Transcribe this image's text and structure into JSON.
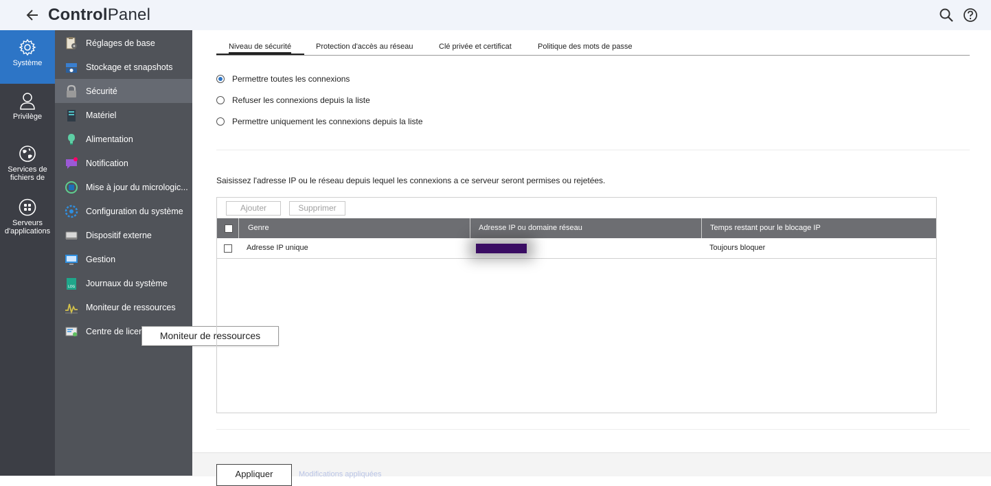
{
  "header": {
    "title_bold": "Control",
    "title_light": "Panel",
    "back_icon": "arrow-left-icon",
    "search_icon": "search-icon",
    "help_icon": "help-icon"
  },
  "rail": {
    "items": [
      {
        "label": "Système",
        "icon": "gear-icon",
        "active": true
      },
      {
        "label": "Privilège",
        "icon": "user-icon"
      },
      {
        "label": "Services de fichiers de",
        "icon": "globe-icon"
      },
      {
        "label": "Serveurs d'applications",
        "icon": "apps-grid-icon"
      }
    ]
  },
  "subnav": {
    "items": [
      {
        "label": "Réglages de base",
        "icon": "settings-clipboard-icon"
      },
      {
        "label": "Stockage et snapshots",
        "icon": "storage-icon"
      },
      {
        "label": "Sécurité",
        "icon": "lock-icon",
        "active": true
      },
      {
        "label": "Matériel",
        "icon": "hardware-icon"
      },
      {
        "label": "Alimentation",
        "icon": "power-bulb-icon"
      },
      {
        "label": "Notification",
        "icon": "notification-icon"
      },
      {
        "label": "Mise à jour du micrologic...",
        "icon": "firmware-update-icon"
      },
      {
        "label": "Configuration du système",
        "icon": "system-config-icon"
      },
      {
        "label": "Dispositif externe",
        "icon": "external-device-icon"
      },
      {
        "label": "Gestion",
        "icon": "monitor-icon"
      },
      {
        "label": "Journaux du système",
        "icon": "log-icon"
      },
      {
        "label": "Moniteur de ressources",
        "icon": "resource-monitor-icon"
      },
      {
        "label": "Centre de licences",
        "icon": "license-icon"
      }
    ],
    "tooltip": "Moniteur de ressources"
  },
  "tabs": [
    {
      "label": "Niveau de sécurité",
      "active": true
    },
    {
      "label": "Protection d'accès au réseau"
    },
    {
      "label": "Clé privée et certificat"
    },
    {
      "label": "Politique des mots de passe"
    }
  ],
  "options": [
    {
      "label": "Permettre toutes les connexions",
      "checked": true
    },
    {
      "label": "Refuser les connexions depuis la liste"
    },
    {
      "label": "Permettre uniquement les connexions depuis la liste"
    }
  ],
  "description": "Saisissez l'adresse IP ou le réseau depuis lequel les connexions a ce serveur seront permises ou rejetées.",
  "grid": {
    "add_label": "Ajouter",
    "delete_label": "Supprimer",
    "columns": [
      "Genre",
      "Adresse IP ou domaine réseau",
      "Temps restant pour le blocage IP"
    ],
    "rows": [
      {
        "type": "Adresse IP unique",
        "address": "",
        "remaining": "Toujours bloquer"
      }
    ]
  },
  "footer": {
    "apply_label": "Appliquer",
    "applied_text": "Modifications appliquées"
  }
}
